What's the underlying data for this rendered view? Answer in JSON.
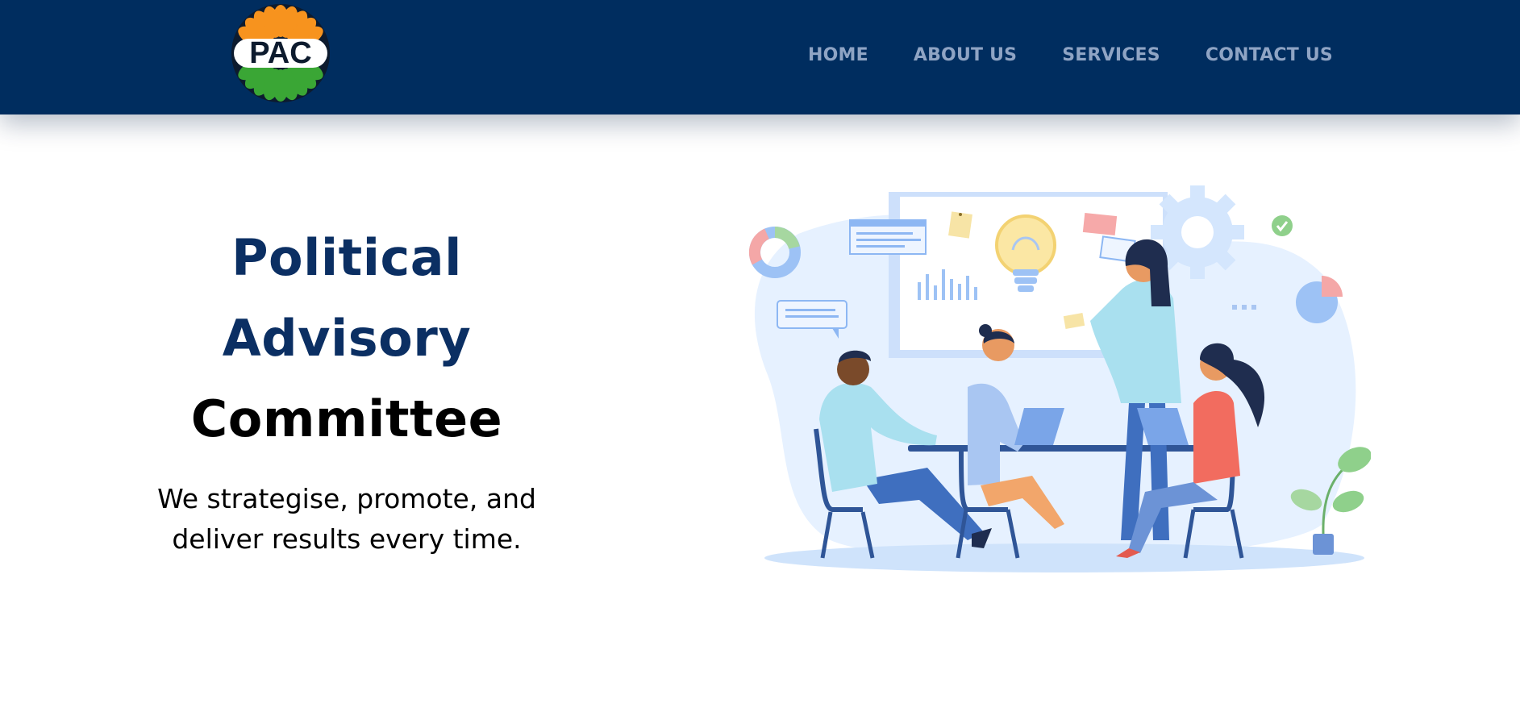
{
  "header": {
    "logo": {
      "text": "PAC",
      "icon": "pac-flower-logo"
    },
    "nav": [
      {
        "label": "HOME"
      },
      {
        "label": "ABOUT US"
      },
      {
        "label": "SERVICES"
      },
      {
        "label": "CONTACT US"
      }
    ]
  },
  "hero": {
    "title_line1": "Political",
    "title_line2": "Advisory",
    "title_line3": "Committee",
    "subtitle_line1": "We strategise, promote, and",
    "subtitle_line2": "deliver results every time.",
    "illustration": "team-meeting-illustration"
  },
  "colors": {
    "header_bg": "#002d5f",
    "nav_text": "#8fa4c4",
    "title_blue": "#0b2f63",
    "saffron": "#f7931e",
    "green": "#3aa635"
  }
}
